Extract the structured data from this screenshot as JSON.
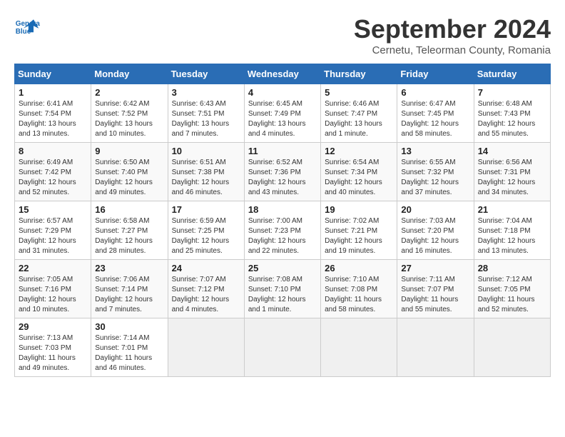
{
  "header": {
    "logo_line1": "General",
    "logo_line2": "Blue",
    "month": "September 2024",
    "location": "Cernetu, Teleorman County, Romania"
  },
  "weekdays": [
    "Sunday",
    "Monday",
    "Tuesday",
    "Wednesday",
    "Thursday",
    "Friday",
    "Saturday"
  ],
  "weeks": [
    [
      {
        "day": "1",
        "info": "Sunrise: 6:41 AM\nSunset: 7:54 PM\nDaylight: 13 hours\nand 13 minutes."
      },
      {
        "day": "2",
        "info": "Sunrise: 6:42 AM\nSunset: 7:52 PM\nDaylight: 13 hours\nand 10 minutes."
      },
      {
        "day": "3",
        "info": "Sunrise: 6:43 AM\nSunset: 7:51 PM\nDaylight: 13 hours\nand 7 minutes."
      },
      {
        "day": "4",
        "info": "Sunrise: 6:45 AM\nSunset: 7:49 PM\nDaylight: 13 hours\nand 4 minutes."
      },
      {
        "day": "5",
        "info": "Sunrise: 6:46 AM\nSunset: 7:47 PM\nDaylight: 13 hours\nand 1 minute."
      },
      {
        "day": "6",
        "info": "Sunrise: 6:47 AM\nSunset: 7:45 PM\nDaylight: 12 hours\nand 58 minutes."
      },
      {
        "day": "7",
        "info": "Sunrise: 6:48 AM\nSunset: 7:43 PM\nDaylight: 12 hours\nand 55 minutes."
      }
    ],
    [
      {
        "day": "8",
        "info": "Sunrise: 6:49 AM\nSunset: 7:42 PM\nDaylight: 12 hours\nand 52 minutes."
      },
      {
        "day": "9",
        "info": "Sunrise: 6:50 AM\nSunset: 7:40 PM\nDaylight: 12 hours\nand 49 minutes."
      },
      {
        "day": "10",
        "info": "Sunrise: 6:51 AM\nSunset: 7:38 PM\nDaylight: 12 hours\nand 46 minutes."
      },
      {
        "day": "11",
        "info": "Sunrise: 6:52 AM\nSunset: 7:36 PM\nDaylight: 12 hours\nand 43 minutes."
      },
      {
        "day": "12",
        "info": "Sunrise: 6:54 AM\nSunset: 7:34 PM\nDaylight: 12 hours\nand 40 minutes."
      },
      {
        "day": "13",
        "info": "Sunrise: 6:55 AM\nSunset: 7:32 PM\nDaylight: 12 hours\nand 37 minutes."
      },
      {
        "day": "14",
        "info": "Sunrise: 6:56 AM\nSunset: 7:31 PM\nDaylight: 12 hours\nand 34 minutes."
      }
    ],
    [
      {
        "day": "15",
        "info": "Sunrise: 6:57 AM\nSunset: 7:29 PM\nDaylight: 12 hours\nand 31 minutes."
      },
      {
        "day": "16",
        "info": "Sunrise: 6:58 AM\nSunset: 7:27 PM\nDaylight: 12 hours\nand 28 minutes."
      },
      {
        "day": "17",
        "info": "Sunrise: 6:59 AM\nSunset: 7:25 PM\nDaylight: 12 hours\nand 25 minutes."
      },
      {
        "day": "18",
        "info": "Sunrise: 7:00 AM\nSunset: 7:23 PM\nDaylight: 12 hours\nand 22 minutes."
      },
      {
        "day": "19",
        "info": "Sunrise: 7:02 AM\nSunset: 7:21 PM\nDaylight: 12 hours\nand 19 minutes."
      },
      {
        "day": "20",
        "info": "Sunrise: 7:03 AM\nSunset: 7:20 PM\nDaylight: 12 hours\nand 16 minutes."
      },
      {
        "day": "21",
        "info": "Sunrise: 7:04 AM\nSunset: 7:18 PM\nDaylight: 12 hours\nand 13 minutes."
      }
    ],
    [
      {
        "day": "22",
        "info": "Sunrise: 7:05 AM\nSunset: 7:16 PM\nDaylight: 12 hours\nand 10 minutes."
      },
      {
        "day": "23",
        "info": "Sunrise: 7:06 AM\nSunset: 7:14 PM\nDaylight: 12 hours\nand 7 minutes."
      },
      {
        "day": "24",
        "info": "Sunrise: 7:07 AM\nSunset: 7:12 PM\nDaylight: 12 hours\nand 4 minutes."
      },
      {
        "day": "25",
        "info": "Sunrise: 7:08 AM\nSunset: 7:10 PM\nDaylight: 12 hours\nand 1 minute."
      },
      {
        "day": "26",
        "info": "Sunrise: 7:10 AM\nSunset: 7:08 PM\nDaylight: 11 hours\nand 58 minutes."
      },
      {
        "day": "27",
        "info": "Sunrise: 7:11 AM\nSunset: 7:07 PM\nDaylight: 11 hours\nand 55 minutes."
      },
      {
        "day": "28",
        "info": "Sunrise: 7:12 AM\nSunset: 7:05 PM\nDaylight: 11 hours\nand 52 minutes."
      }
    ],
    [
      {
        "day": "29",
        "info": "Sunrise: 7:13 AM\nSunset: 7:03 PM\nDaylight: 11 hours\nand 49 minutes."
      },
      {
        "day": "30",
        "info": "Sunrise: 7:14 AM\nSunset: 7:01 PM\nDaylight: 11 hours\nand 46 minutes."
      },
      {
        "day": "",
        "info": ""
      },
      {
        "day": "",
        "info": ""
      },
      {
        "day": "",
        "info": ""
      },
      {
        "day": "",
        "info": ""
      },
      {
        "day": "",
        "info": ""
      }
    ]
  ]
}
